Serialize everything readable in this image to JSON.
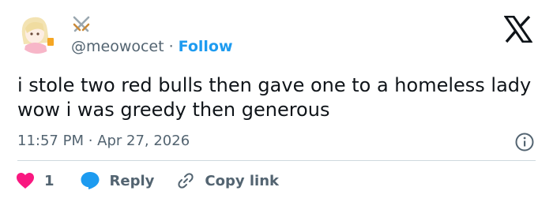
{
  "author": {
    "handle": "@meowocet",
    "separator": "·",
    "follow_label": "Follow",
    "display_name_icon": "crossed-swords-icon"
  },
  "tweet": {
    "text": "i stole two red bulls then gave one to a homeless lady wow i was greedy then generous",
    "timestamp": "11:57 PM · Apr 27, 2026"
  },
  "actions": {
    "like_count": "1",
    "reply_label": "Reply",
    "copy_link_label": "Copy link"
  },
  "icons": [
    "x-logo-icon",
    "info-icon",
    "heart-icon",
    "reply-bubble-icon",
    "link-icon"
  ],
  "colors": {
    "text": "#0f1419",
    "muted": "#536471",
    "accent": "#1d9bf0",
    "like": "#f91880",
    "divider": "#cfd9de"
  }
}
